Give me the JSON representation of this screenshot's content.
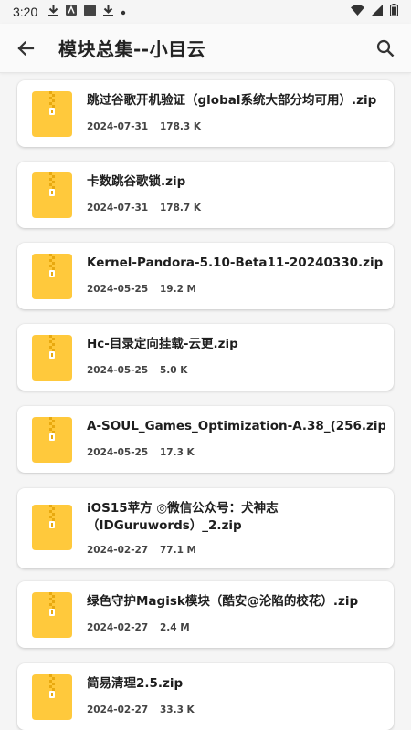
{
  "status": {
    "time": "3:20"
  },
  "app_bar": {
    "title": "模块总集--小目云"
  },
  "colors": {
    "zip_yellow": "#FFC93C",
    "zip_stripe": "#E8A90F"
  },
  "files": [
    {
      "name": "跳过谷歌开机验证（global系统大部分均可用）.zip",
      "date": "2024-07-31",
      "size": "178.3 K"
    },
    {
      "name": "卡数跳谷歌锁.zip",
      "date": "2024-07-31",
      "size": "178.7 K"
    },
    {
      "name": "Kernel-Pandora-5.10-Beta11-20240330.zip",
      "date": "2024-05-25",
      "size": "19.2 M"
    },
    {
      "name": "Hc-目录定向挂载-云更.zip",
      "date": "2024-05-25",
      "size": "5.0 K"
    },
    {
      "name": "A-SOUL_Games_Optimization-A.38_(256.zip",
      "date": "2024-05-25",
      "size": "17.3 K"
    },
    {
      "name": "iOS15苹方 ◎微信公众号：犬神志（IDGuruwords）_2.zip",
      "date": "2024-02-27",
      "size": "77.1 M"
    },
    {
      "name": "绿色守护Magisk模块（酷安@沦陷的校花）.zip",
      "date": "2024-02-27",
      "size": "2.4 M"
    },
    {
      "name": "简易清理2.5.zip",
      "date": "2024-02-27",
      "size": "33.3 K"
    }
  ]
}
